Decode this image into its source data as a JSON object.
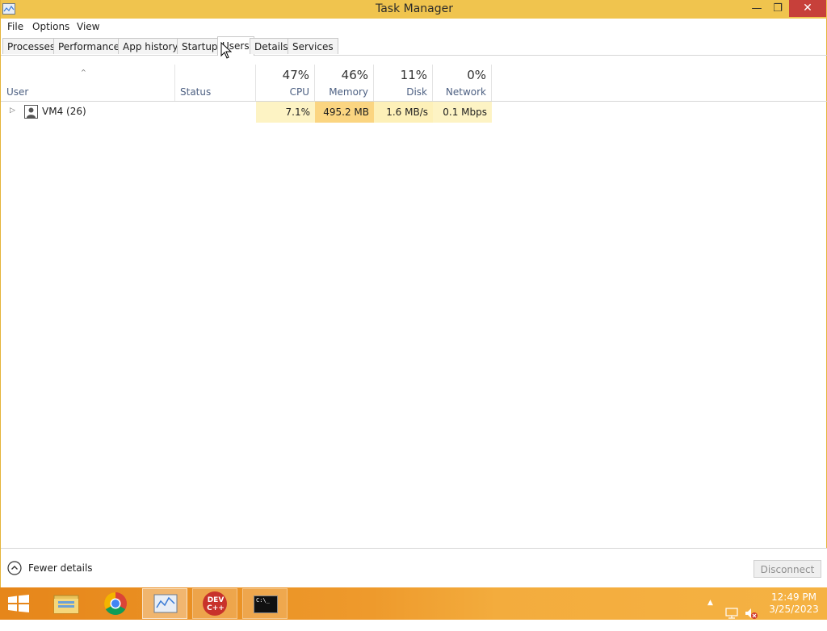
{
  "window": {
    "title": "Task Manager",
    "minimize_glyph": "—",
    "maximize_glyph": "❐",
    "close_glyph": "✕",
    "accent_color": "#f0c44e"
  },
  "menu": {
    "items": [
      "File",
      "Options",
      "View"
    ]
  },
  "tabs": {
    "items": [
      "Processes",
      "Performance",
      "App history",
      "Startup",
      "Users",
      "Details",
      "Services"
    ],
    "active": "Users"
  },
  "table": {
    "columns": {
      "user": "User",
      "status": "Status",
      "cpu": {
        "pct": "47%",
        "label": "CPU"
      },
      "memory": {
        "pct": "46%",
        "label": "Memory"
      },
      "disk": {
        "pct": "11%",
        "label": "Disk"
      },
      "network": {
        "pct": "0%",
        "label": "Network"
      }
    },
    "sort_glyph": "^",
    "rows": [
      {
        "expand_glyph": "▷",
        "user": "VM4 (26)",
        "status": "",
        "cpu": "7.1%",
        "memory": "495.2 MB",
        "disk": "1.6 MB/s",
        "network": "0.1 Mbps"
      }
    ]
  },
  "footer": {
    "fewer_details": "Fewer details",
    "disconnect": "Disconnect"
  },
  "taskbar": {
    "devcpp_label": "DEV C++",
    "cmd_label": "C:\\_",
    "tray_arrow_glyph": "▲",
    "clock_time": "12:49 PM",
    "clock_date": "3/25/2023"
  }
}
